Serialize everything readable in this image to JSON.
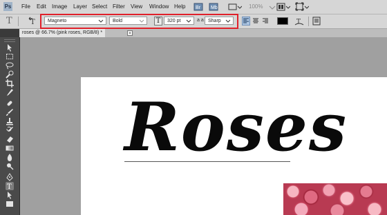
{
  "app": {
    "logo": "Ps"
  },
  "menu": [
    "File",
    "Edit",
    "Image",
    "Layer",
    "Select",
    "Filter",
    "View",
    "Window",
    "Help"
  ],
  "menu_right": {
    "zoom": "100%"
  },
  "options": {
    "font_family": "Magneto",
    "font_style": "Bold",
    "font_size_icon_label": "T",
    "font_size": "320 pt",
    "aa_label": "a a",
    "antialias": "Sharp",
    "tool_icon": "T"
  },
  "document": {
    "tab_title": "roses @ 66.7% (pink roses, RGB/8) *",
    "close_glyph": "×",
    "canvas_text": "Roses"
  },
  "colors": {
    "highlight": "#e0202a",
    "swatch": "#000000"
  }
}
